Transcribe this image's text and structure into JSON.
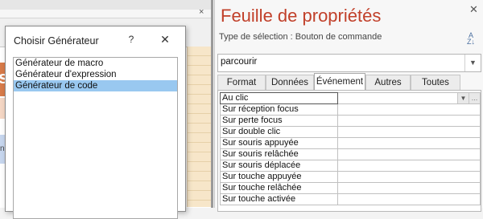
{
  "design": {
    "orange_letter": "s",
    "blue_text": "n"
  },
  "dialog": {
    "title": "Choisir Générateur",
    "help": "?",
    "close": "✕",
    "items": [
      "Générateur de macro",
      "Générateur d'expression",
      "Générateur de code"
    ],
    "selected_index": 2
  },
  "props": {
    "title": "Feuille de propriétés",
    "selection_type": "Type de sélection : Bouton de commande",
    "object_combo": "parcourir",
    "tabs": [
      "Format",
      "Données",
      "Événement",
      "Autres",
      "Toutes"
    ],
    "active_tab": "Événement",
    "rows": [
      "Au clic",
      "Sur réception focus",
      "Sur perte focus",
      "Sur double clic",
      "Sur souris appuyée",
      "Sur souris relâchée",
      "Sur souris déplacée",
      "Sur touche appuyée",
      "Sur touche relâchée",
      "Sur touche activée"
    ]
  }
}
